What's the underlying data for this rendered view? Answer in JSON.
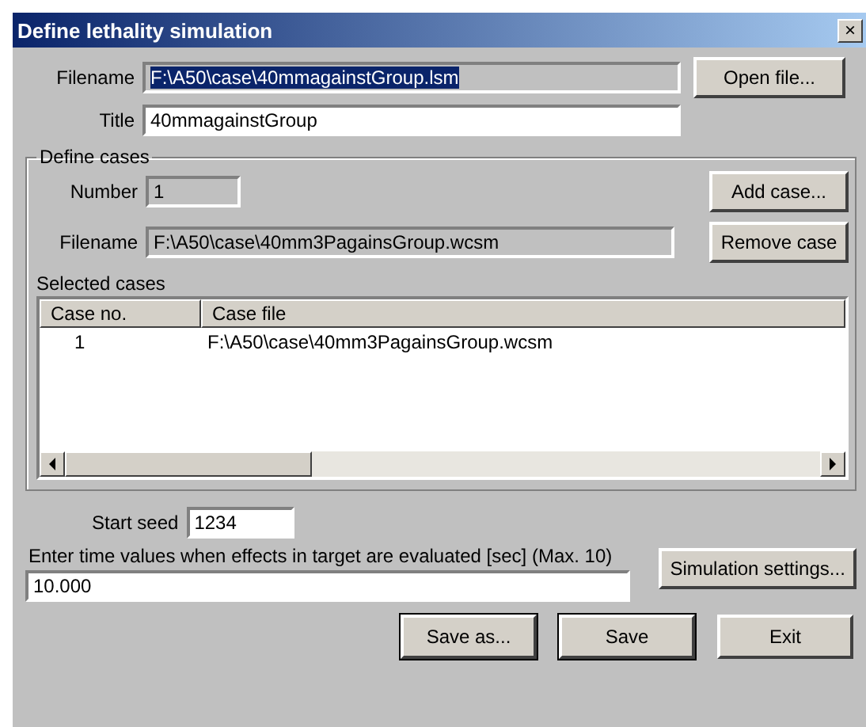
{
  "window": {
    "title": "Define lethality simulation",
    "close": "×"
  },
  "file": {
    "filename_label": "Filename",
    "filename": {
      "value": "F:\\A50\\case\\40mmagainstGroup.lsm",
      "disabled": true,
      "text_selected": true
    },
    "open_button": "Open file...",
    "title_label": "Title",
    "title": {
      "value": "40mmagainstGroup",
      "disabled": false,
      "text_selected": false
    }
  },
  "define_cases": {
    "legend": "Define cases",
    "number_label": "Number",
    "number": {
      "value": "1",
      "disabled": true,
      "text_selected": false
    },
    "add_button": "Add case...",
    "filename_label": "Filename",
    "filename": {
      "value": "F:\\A50\\case\\40mm3PagainsGroup.wcsm",
      "disabled": true,
      "text_selected": false
    },
    "remove_button": "Remove case",
    "selected_label": "Selected cases",
    "table": {
      "columns": [
        "Case no.",
        "Case file"
      ],
      "rows": [
        {
          "cells": [
            "1",
            "F:\\A50\\case\\40mm3PagainsGroup.wcsm"
          ],
          "selected": false
        }
      ]
    }
  },
  "seed_label": "Start seed",
  "seed": {
    "value": "1234",
    "disabled": false,
    "text_selected": false
  },
  "settings_button": "Simulation settings...",
  "time_label": "Enter time values when effects in target are evaluated [sec] (Max. 10)",
  "time": {
    "value": "10.000",
    "disabled": false,
    "text_selected": false
  },
  "buttons": [
    "Save as...",
    "Save",
    "Exit"
  ]
}
